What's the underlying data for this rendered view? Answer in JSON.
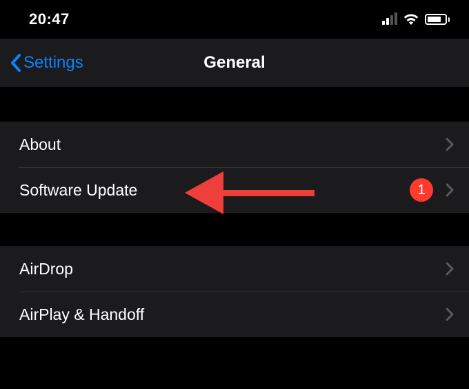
{
  "status": {
    "time": "20:47"
  },
  "nav": {
    "back_label": "Settings",
    "title": "General"
  },
  "group1": {
    "about": "About",
    "software_update": "Software Update",
    "software_update_badge": "1"
  },
  "group2": {
    "airdrop": "AirDrop",
    "airplay": "AirPlay & Handoff"
  }
}
